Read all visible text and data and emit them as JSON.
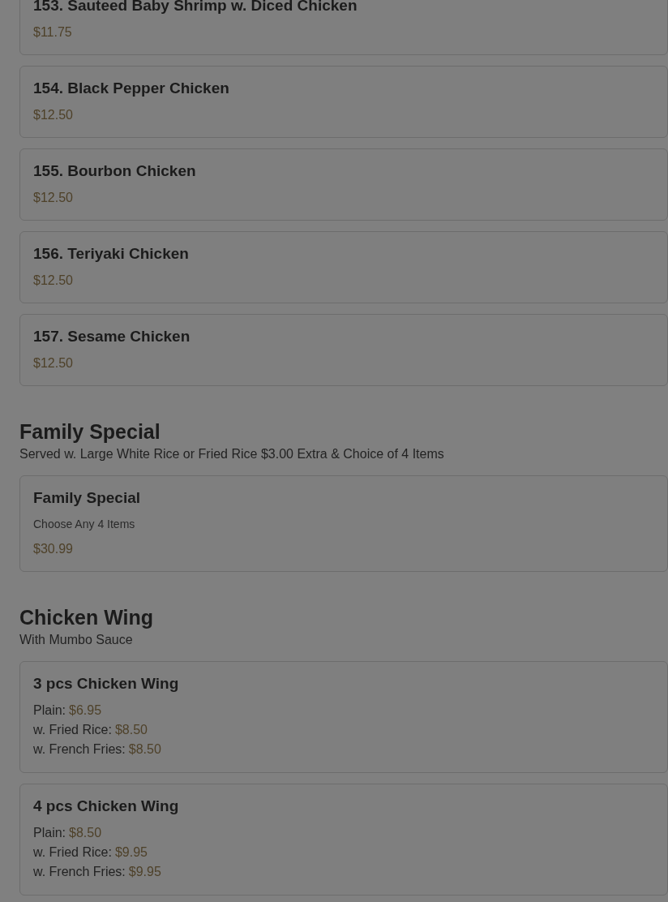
{
  "sections": [
    {
      "items": [
        {
          "name": "153. Sauteed Baby Shrimp w. Diced Chicken",
          "price": "$11.75"
        },
        {
          "name": "154. Black Pepper Chicken",
          "price": "$12.50"
        },
        {
          "name": "155. Bourbon Chicken",
          "price": "$12.50"
        },
        {
          "name": "156. Teriyaki Chicken",
          "price": "$12.50"
        },
        {
          "name": "157. Sesame Chicken",
          "price": "$12.50"
        }
      ]
    },
    {
      "title": "Family Special",
      "subtitle": "Served w. Large White Rice or Fried Rice $3.00 Extra & Choice of 4 Items",
      "items": [
        {
          "name": "Family Special",
          "description": "Choose Any 4 Items",
          "price": "$30.99"
        }
      ]
    },
    {
      "title": "Chicken Wing",
      "subtitle": "With Mumbo Sauce",
      "items": [
        {
          "name": "3 pcs Chicken Wing",
          "options": [
            {
              "label": "Plain:",
              "price": "$6.95"
            },
            {
              "label": "w. Fried Rice:",
              "price": "$8.50"
            },
            {
              "label": "w. French Fries:",
              "price": "$8.50"
            }
          ]
        },
        {
          "name": "4 pcs Chicken Wing",
          "options": [
            {
              "label": "Plain:",
              "price": "$8.50"
            },
            {
              "label": "w. Fried Rice:",
              "price": "$9.95"
            },
            {
              "label": "w. French Fries:",
              "price": "$9.95"
            }
          ]
        }
      ]
    }
  ]
}
